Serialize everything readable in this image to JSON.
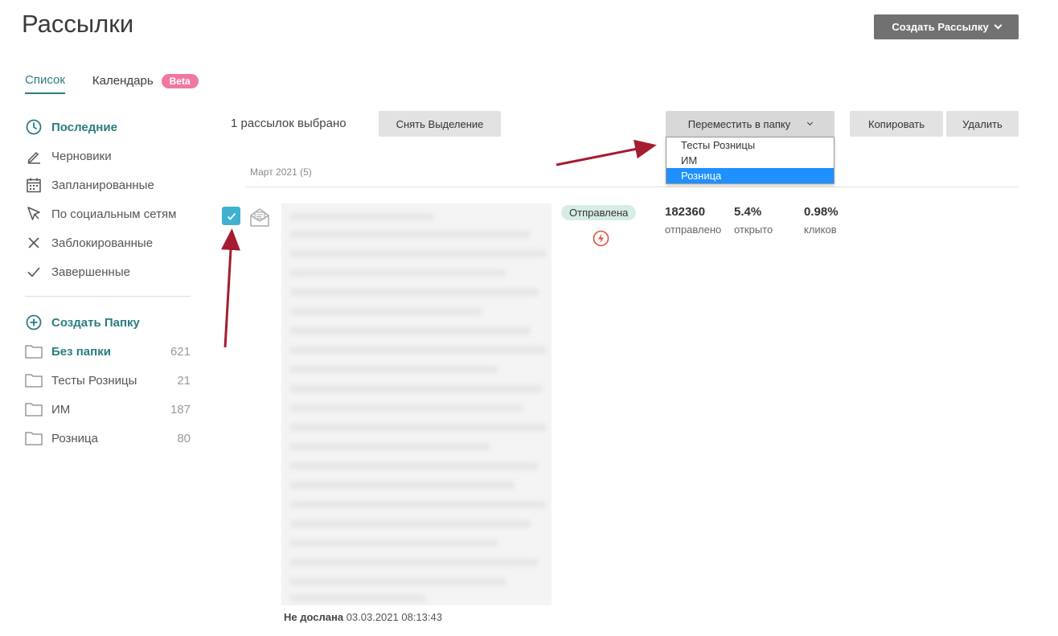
{
  "page_title": "Рассылки",
  "header": {
    "create_button_label": "Создать Рассылку"
  },
  "tabs": [
    {
      "label": "Список"
    },
    {
      "label": "Календарь",
      "badge": "Beta"
    }
  ],
  "sidebar": {
    "nav": [
      {
        "label": "Последние",
        "icon": "clock-icon"
      },
      {
        "label": "Черновики",
        "icon": "pencil-icon"
      },
      {
        "label": "Запланированные",
        "icon": "calendar-icon"
      },
      {
        "label": "По социальным сетям",
        "icon": "cursor-icon"
      },
      {
        "label": "Заблокированные",
        "icon": "close-icon"
      },
      {
        "label": "Завершенные",
        "icon": "check-icon"
      }
    ],
    "create_folder_label": "Создать Папку",
    "folders": [
      {
        "name": "Без папки",
        "count": "621"
      },
      {
        "name": "Тесты Розницы",
        "count": "21"
      },
      {
        "name": "ИМ",
        "count": "187"
      },
      {
        "name": "Розница",
        "count": "80"
      }
    ]
  },
  "toolbar": {
    "selected_text": "1 рассылок выбрано",
    "deselect_label": "Снять Выделение",
    "move_label": "Переместить в папку",
    "copy_label": "Копировать",
    "delete_label": "Удалить"
  },
  "move_dropdown": {
    "options": [
      "Тесты Розницы",
      "ИМ",
      "Розница"
    ],
    "selected": "Розница"
  },
  "list": {
    "month_label": "Март 2021 (5)",
    "item": {
      "status": "Отправлена",
      "stats": [
        {
          "value": "182360",
          "label": "отправлено"
        },
        {
          "value": "5.4%",
          "label": "открыто"
        },
        {
          "value": "0.98%",
          "label": "кликов"
        }
      ],
      "note_label": "Не дослана",
      "note_time": "03.03.2021 08:13:43"
    }
  },
  "colors": {
    "accent": "#2b7c80",
    "checkbox": "#3fb1cf",
    "status_bg": "#d7ece6",
    "arrow": "#a51c30",
    "dropdown_selected": "#1e90ff"
  }
}
